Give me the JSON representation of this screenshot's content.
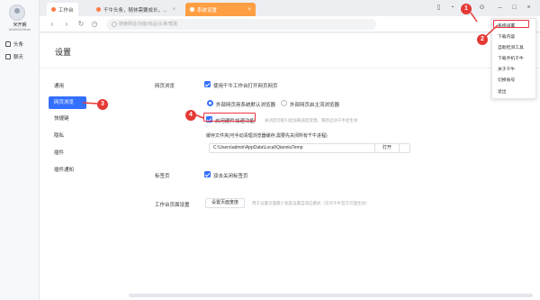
{
  "user": {
    "name": "米开朗",
    "id": "82880028bdn"
  },
  "side_nav": [
    {
      "label": "头条"
    },
    {
      "label": "聊天"
    }
  ],
  "tabs": [
    {
      "label": "工作台"
    },
    {
      "label": "千牛头条，随休需要成长，..."
    },
    {
      "label": "系统设置"
    }
  ],
  "address": {
    "placeholder": "搜索网址/功能/商品/头条/帮助"
  },
  "settings": {
    "title": "设置",
    "nav": [
      {
        "label": "通用"
      },
      {
        "label": "网页浏览"
      },
      {
        "label": "快捷键"
      },
      {
        "label": "隐私"
      },
      {
        "label": "插件"
      },
      {
        "label": "插件通知"
      }
    ],
    "browse": {
      "section": "网页浏览",
      "open_in_qianniu": "使用千牛工作台打开网页网页",
      "radio_system": "外部网页用系统默认浏览器",
      "radio_self": "外部网页启主流浏览器",
      "hw_accel": "启用硬件加速功能",
      "hw_hint": "关闭后可能引起加载速度变慢，重新启动千牛后生效",
      "cache_label": "缓存文件夹(可手动清理浏览器缓存,需要先关闭所有千牛进程)",
      "cache_path": "C:\\Users\\admin\\AppData\\Local\\QianniuTemp",
      "open_btn": "打开"
    },
    "tabs_section": {
      "section": "标签页",
      "close_dbl": "双击关闭标签页"
    },
    "workbench": {
      "section": "工作台页面设置",
      "btn": "设置页面宽度",
      "hint": "用于设置页面最小宽度设置自适应模式（仅对千牛官方页面生效）"
    }
  },
  "menu": {
    "items": [
      {
        "label": "系统设置"
      },
      {
        "label": "下载内容"
      },
      {
        "label": "自助检测工具"
      },
      {
        "label": "下载手机千牛"
      },
      {
        "label": "关于千牛"
      },
      {
        "label": "切换账号"
      },
      {
        "label": "退出"
      }
    ]
  },
  "annotations": [
    "1",
    "2",
    "3",
    "4"
  ],
  "colors": {
    "accent": "#3370ff",
    "active_tab": "#ff9f43",
    "annotation": "#e53935"
  },
  "icons": [
    "home-icon",
    "chat-icon",
    "phone-icon",
    "bell-icon",
    "menu-icon",
    "minimize-icon",
    "maximize-icon",
    "close-icon",
    "back-icon",
    "forward-icon",
    "refresh-icon",
    "history-icon"
  ]
}
